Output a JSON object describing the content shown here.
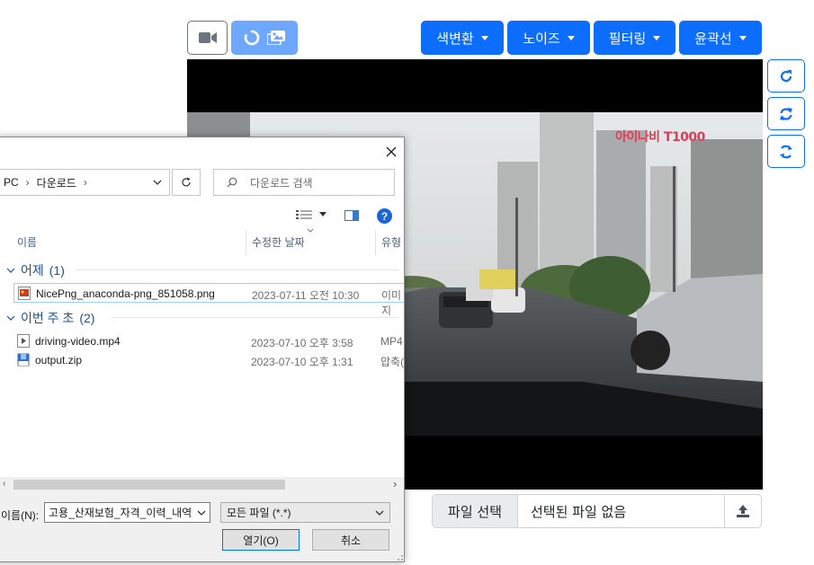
{
  "toolbar": {
    "dropdowns": [
      {
        "label": "색변환"
      },
      {
        "label": "노이즈"
      },
      {
        "label": "필터링"
      },
      {
        "label": "윤곽선"
      }
    ]
  },
  "video": {
    "watermark": "아이나비 T1000"
  },
  "file_input": {
    "button_label": "파일 선택",
    "status_text": "선택된 파일 없음"
  },
  "dialog": {
    "breadcrumb": {
      "part1": "PC",
      "part2": "다운로드"
    },
    "search_placeholder": "다운로드 검색",
    "columns": {
      "name": "이름",
      "date": "수정한 날짜",
      "type": "유형"
    },
    "groups": [
      {
        "title": "어제",
        "count": "(1)",
        "files": [
          {
            "name": "NicePng_anaconda-png_851058.png",
            "date": "2023-07-11 오전 10:30",
            "type": "이미지"
          }
        ]
      },
      {
        "title": "이번 주 초",
        "count": "(2)",
        "files": [
          {
            "name": "driving-video.mp4",
            "date": "2023-07-10 오후 3:58",
            "type": "MP4"
          },
          {
            "name": "output.zip",
            "date": "2023-07-10 오후 1:31",
            "type": "압축("
          }
        ]
      }
    ],
    "filename_label": "이름(N):",
    "filename_value": "고용_산재보험_자격_이력_내역",
    "filetype_value": "모든 파일 (*.*)",
    "open_label": "열기(O)",
    "cancel_label": "취소"
  },
  "colors": {
    "primary": "#0d6efd",
    "primary_light": "#6ea8fe",
    "group_text": "#1f4e9c"
  }
}
